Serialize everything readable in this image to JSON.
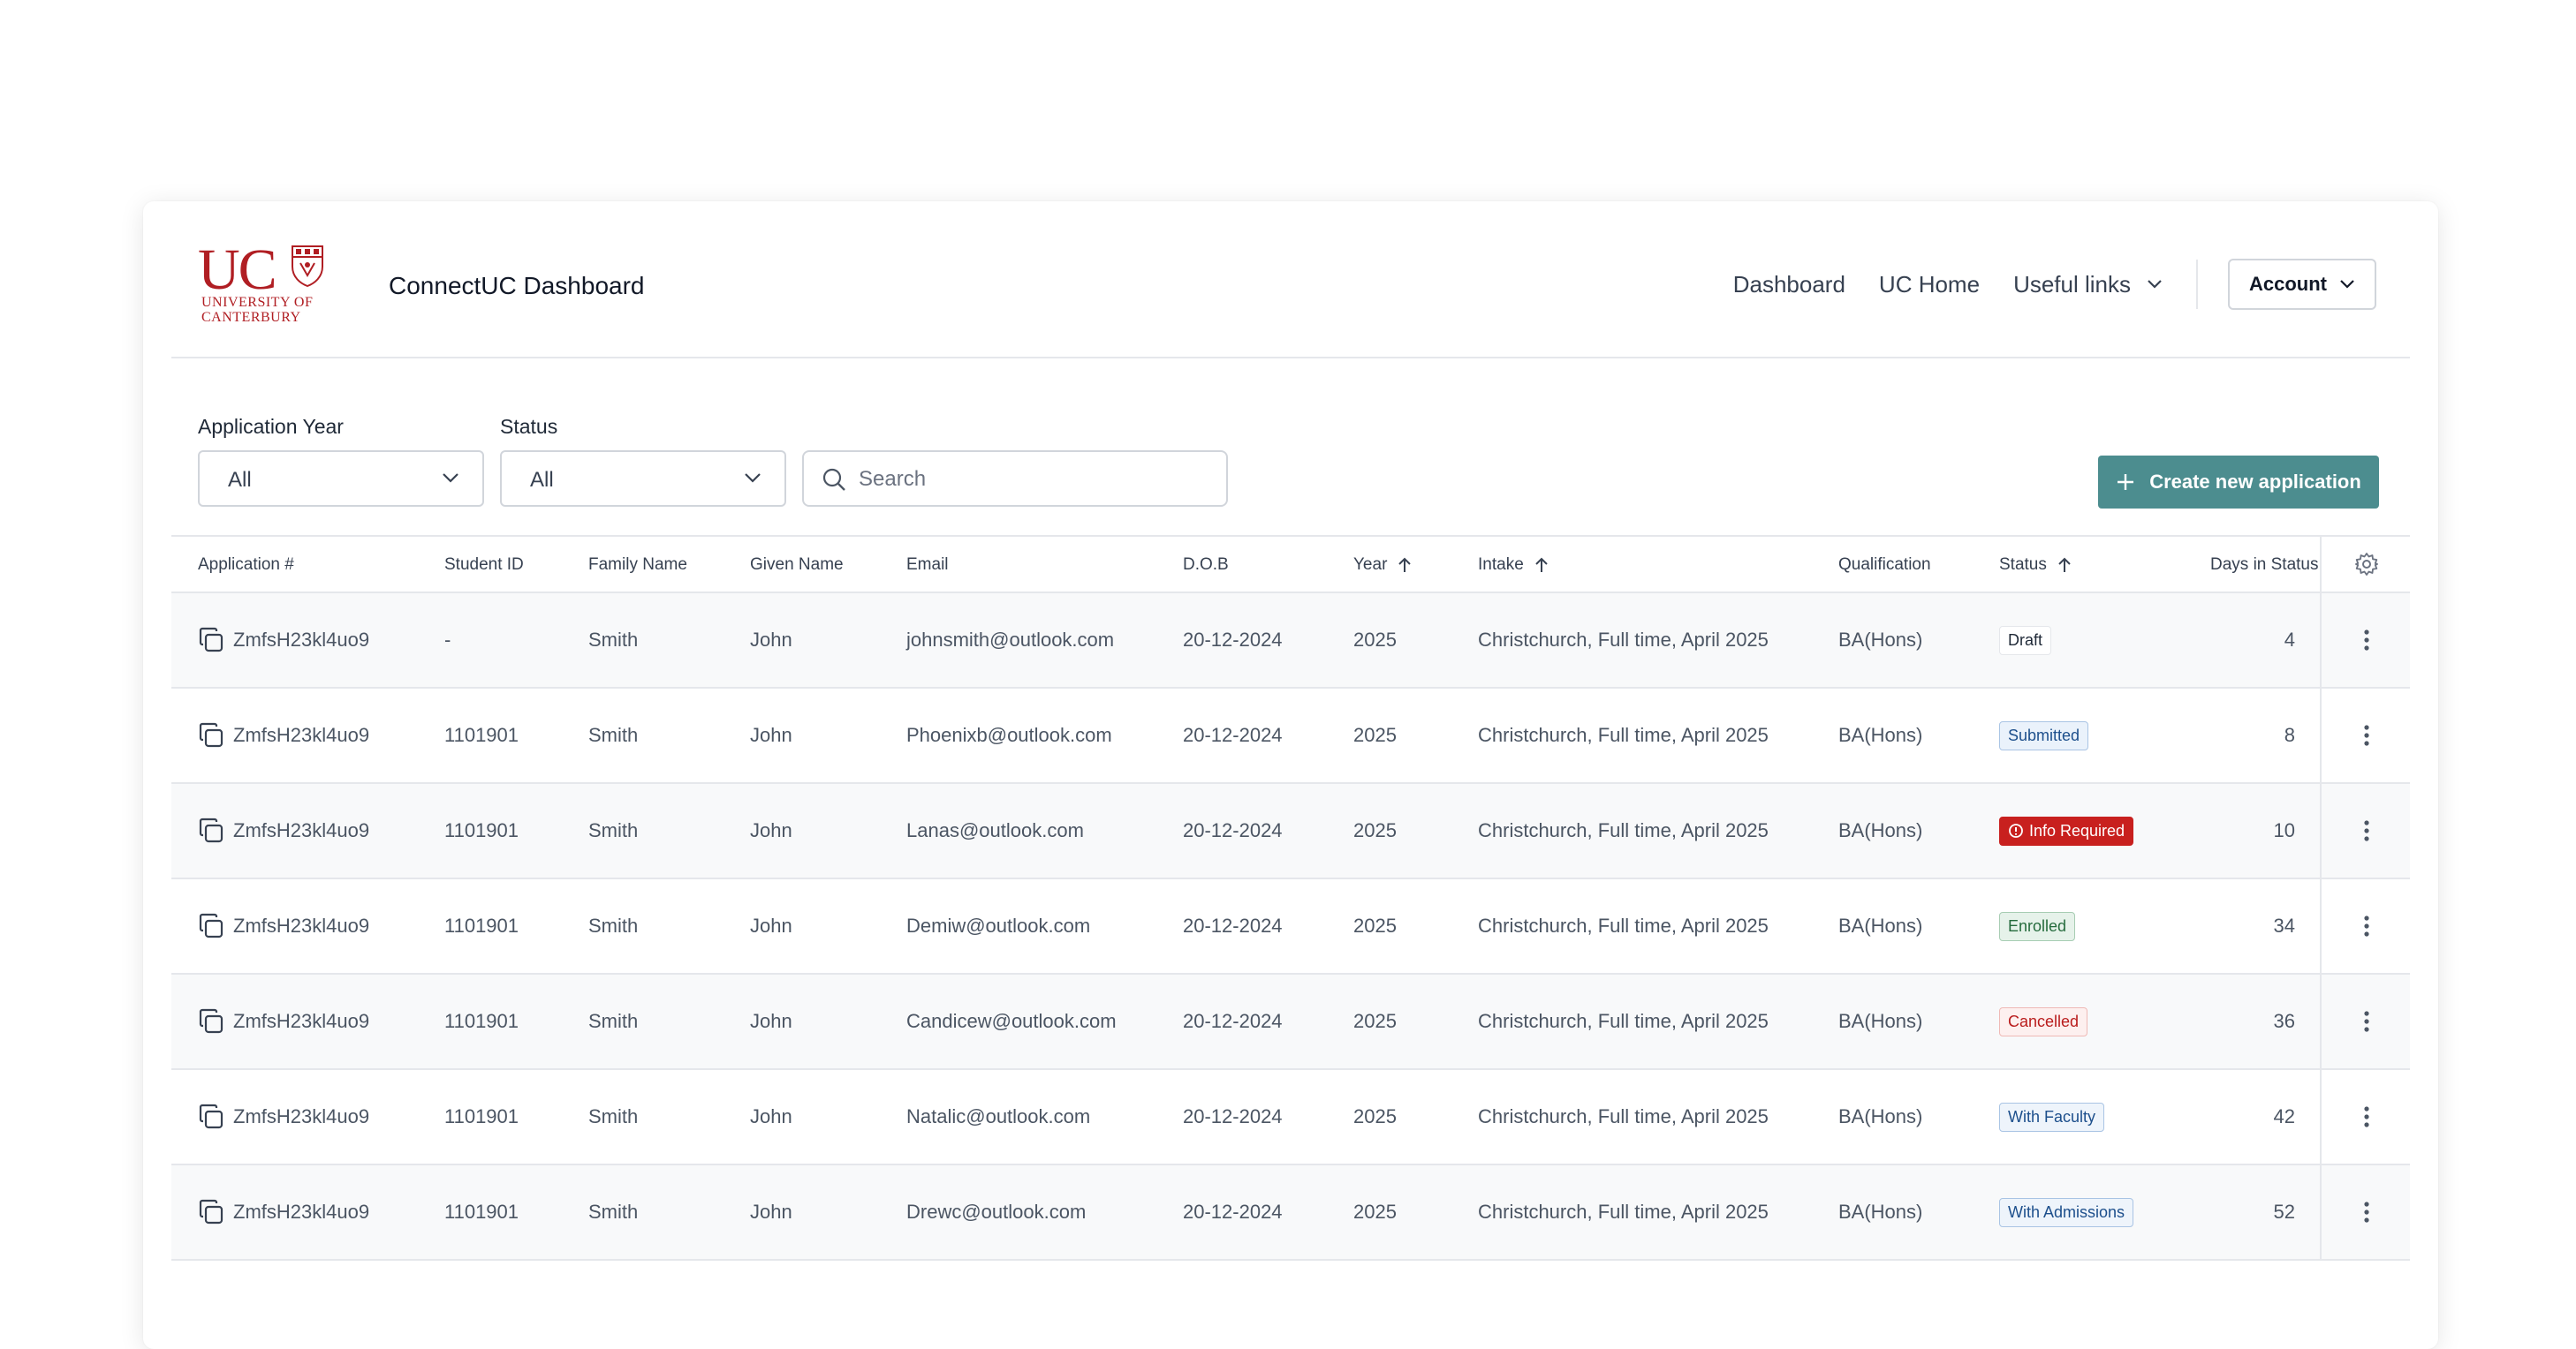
{
  "header": {
    "logo_text": "UC",
    "logo_university": "UNIVERSITY OF",
    "logo_canterbury": "CANTERBURY",
    "app_title": "ConnectUC Dashboard",
    "nav": {
      "dashboard": "Dashboard",
      "uc_home": "UC Home",
      "useful_links": "Useful links",
      "account": "Account"
    }
  },
  "filters": {
    "year_label": "Application Year",
    "year_value": "All",
    "status_label": "Status",
    "status_value": "All",
    "search_placeholder": "Search",
    "create_label": "Create new application"
  },
  "colors": {
    "brand_red": "#b01e23",
    "accent_teal": "#4c8d8f"
  },
  "table": {
    "columns": {
      "app": "Application #",
      "student": "Student ID",
      "family": "Family Name",
      "given": "Given Name",
      "email": "Email",
      "dob": "D.O.B",
      "year": "Year",
      "intake": "Intake",
      "qual": "Qualification",
      "status": "Status",
      "days": "Days in Status"
    },
    "rows": [
      {
        "app": "ZmfsH23kl4uo9",
        "student": "-",
        "family": "Smith",
        "given": "John",
        "email": "johnsmith@outlook.com",
        "dob": "20-12-2024",
        "year": "2025",
        "intake": "Christchurch, Full time, April 2025",
        "qual": "BA(Hons)",
        "status": "Draft",
        "days": "4"
      },
      {
        "app": "ZmfsH23kl4uo9",
        "student": "1101901",
        "family": "Smith",
        "given": "John",
        "email": "Phoenixb@outlook.com",
        "dob": "20-12-2024",
        "year": "2025",
        "intake": "Christchurch, Full time, April 2025",
        "qual": "BA(Hons)",
        "status": "Submitted",
        "days": "8"
      },
      {
        "app": "ZmfsH23kl4uo9",
        "student": "1101901",
        "family": "Smith",
        "given": "John",
        "email": "Lanas@outlook.com",
        "dob": "20-12-2024",
        "year": "2025",
        "intake": "Christchurch, Full time, April 2025",
        "qual": "BA(Hons)",
        "status": "Info Required",
        "days": "10"
      },
      {
        "app": "ZmfsH23kl4uo9",
        "student": "1101901",
        "family": "Smith",
        "given": "John",
        "email": "Demiw@outlook.com",
        "dob": "20-12-2024",
        "year": "2025",
        "intake": "Christchurch, Full time, April 2025",
        "qual": "BA(Hons)",
        "status": "Enrolled",
        "days": "34"
      },
      {
        "app": "ZmfsH23kl4uo9",
        "student": "1101901",
        "family": "Smith",
        "given": "John",
        "email": "Candicew@outlook.com",
        "dob": "20-12-2024",
        "year": "2025",
        "intake": "Christchurch, Full time, April 2025",
        "qual": "BA(Hons)",
        "status": "Cancelled",
        "days": "36"
      },
      {
        "app": "ZmfsH23kl4uo9",
        "student": "1101901",
        "family": "Smith",
        "given": "John",
        "email": "Natalic@outlook.com",
        "dob": "20-12-2024",
        "year": "2025",
        "intake": "Christchurch, Full time, April 2025",
        "qual": "BA(Hons)",
        "status": "With Faculty",
        "days": "42"
      },
      {
        "app": "ZmfsH23kl4uo9",
        "student": "1101901",
        "family": "Smith",
        "given": "John",
        "email": "Drewc@outlook.com",
        "dob": "20-12-2024",
        "year": "2025",
        "intake": "Christchurch, Full time, April 2025",
        "qual": "BA(Hons)",
        "status": "With Admissions",
        "days": "52"
      }
    ],
    "status_styles": {
      "Draft": {
        "bg": "#ffffff",
        "fg": "#1f2937",
        "border": "#e5e7eb"
      },
      "Submitted": {
        "bg": "#eaf2fb",
        "fg": "#1d4f8c",
        "border": "#a9c4e4"
      },
      "Info Required": {
        "bg": "#c8201e",
        "fg": "#ffffff",
        "border": "#c8201e",
        "icon": "alert-circle-icon"
      },
      "Enrolled": {
        "bg": "#e6f2ea",
        "fg": "#256b3d",
        "border": "#a7cdb3"
      },
      "Cancelled": {
        "bg": "#fdf0ef",
        "fg": "#b91c1c",
        "border": "#efb9b5"
      },
      "With Faculty": {
        "bg": "#eef4fb",
        "fg": "#1d4f8c",
        "border": "#a9c4e4"
      },
      "With Admissions": {
        "bg": "#eef4fb",
        "fg": "#1d4f8c",
        "border": "#a9c4e4"
      }
    }
  }
}
